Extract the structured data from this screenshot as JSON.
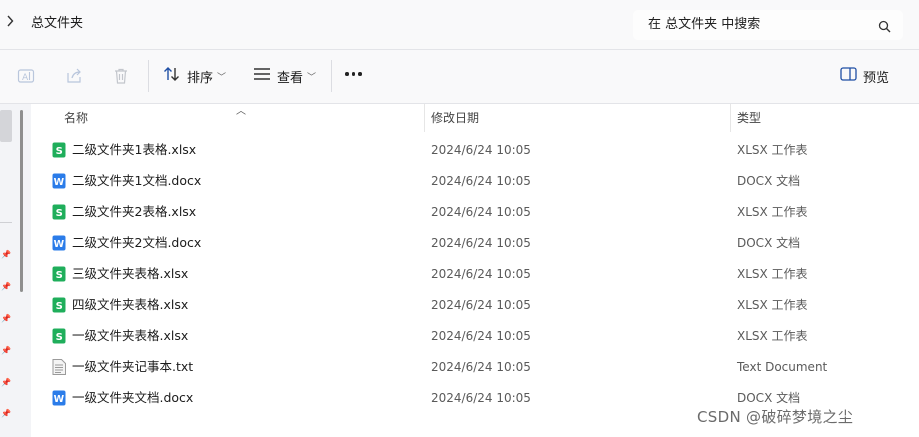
{
  "address_bar": {
    "breadcrumb": "总文件夹",
    "search_placeholder": "在 总文件夹 中搜索"
  },
  "toolbar": {
    "sort_label": "排序",
    "view_label": "查看",
    "preview_label": "预览"
  },
  "columns": {
    "name": "名称",
    "modified": "修改日期",
    "type": "类型"
  },
  "files": [
    {
      "name": "二级文件夹1表格.xlsx",
      "modified": "2024/6/24 10:05",
      "type": "XLSX 工作表",
      "icon": "xlsx-icon"
    },
    {
      "name": "二级文件夹1文档.docx",
      "modified": "2024/6/24 10:05",
      "type": "DOCX 文档",
      "icon": "docx-icon"
    },
    {
      "name": "二级文件夹2表格.xlsx",
      "modified": "2024/6/24 10:05",
      "type": "XLSX 工作表",
      "icon": "xlsx-icon"
    },
    {
      "name": "二级文件夹2文档.docx",
      "modified": "2024/6/24 10:05",
      "type": "DOCX 文档",
      "icon": "docx-icon"
    },
    {
      "name": "三级文件夹表格.xlsx",
      "modified": "2024/6/24 10:05",
      "type": "XLSX 工作表",
      "icon": "xlsx-icon"
    },
    {
      "name": "四级文件夹表格.xlsx",
      "modified": "2024/6/24 10:05",
      "type": "XLSX 工作表",
      "icon": "xlsx-icon"
    },
    {
      "name": "一级文件夹表格.xlsx",
      "modified": "2024/6/24 10:05",
      "type": "XLSX 工作表",
      "icon": "xlsx-icon"
    },
    {
      "name": "一级文件夹记事本.txt",
      "modified": "2024/6/24 10:05",
      "type": "Text Document",
      "icon": "txt-icon"
    },
    {
      "name": "一级文件夹文档.docx",
      "modified": "2024/6/24 10:05",
      "type": "DOCX 文档",
      "icon": "docx-icon"
    }
  ],
  "watermark": "CSDN @破碎梦境之尘",
  "colors": {
    "xlsx": "#1fae5b",
    "docx": "#2b7ce9",
    "txt": "#9a9a9a"
  }
}
